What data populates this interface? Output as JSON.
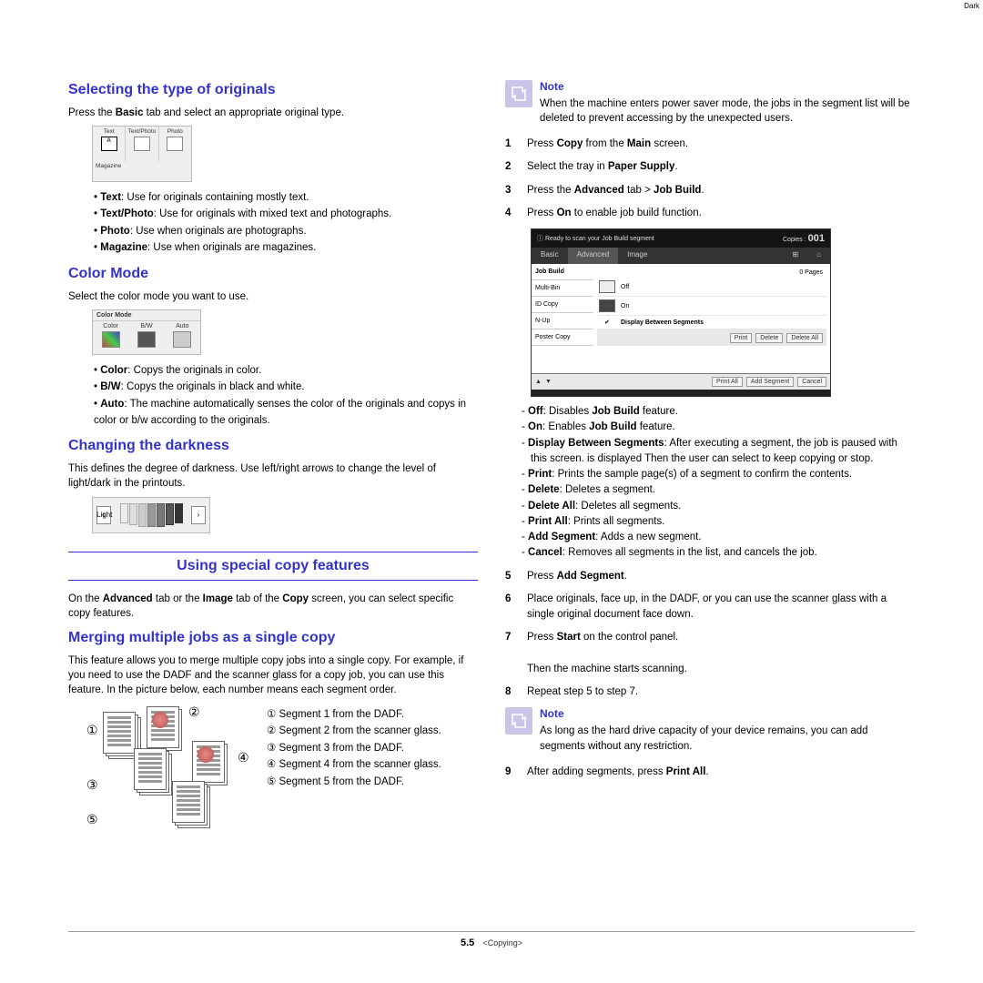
{
  "left": {
    "h_originals": "Selecting the type of originals",
    "p_originals_pre": "Press the ",
    "p_originals_b": "Basic",
    "p_originals_post": " tab and select an appropriate original type.",
    "orig_labels": {
      "text": "Text",
      "textphoto": "Text/Photo",
      "photo": "Photo",
      "magazine": "Magazine"
    },
    "originals": [
      {
        "b": "Text",
        "t": ": Use for originals containing mostly text."
      },
      {
        "b": "Text/Photo",
        "t": ": Use for originals with mixed text and photographs."
      },
      {
        "b": "Photo",
        "t": ": Use when originals are photographs."
      },
      {
        "b": "Magazine",
        "t": ": Use when originals are magazines."
      }
    ],
    "h_color": "Color Mode",
    "p_color": "Select the color mode you want to use.",
    "color_labels": {
      "title": "Color Mode",
      "color": "Color",
      "bw": "B/W",
      "auto": "Auto"
    },
    "colors": [
      {
        "b": "Color",
        "t": ": Copys the originals in color."
      },
      {
        "b": "B/W",
        "t": ": Copys the originals in black and white."
      },
      {
        "b": "Auto",
        "t": ": The machine automatically senses the color of the originals and copys in color or b/w according to the originals."
      }
    ],
    "h_dark": "Changing the darkness",
    "p_dark": "This defines the degree of darkness. Use left/right arrows to change the level of light/dark in the printouts.",
    "dark_labels": {
      "light": "Light",
      "dark": "Dark"
    },
    "h_special": "Using special copy features",
    "p_special": {
      "pre": "On the ",
      "b1": "Advanced",
      "mid": " tab or the ",
      "b2": "Image",
      "mid2": " tab of the ",
      "b3": "Copy",
      "post": " screen, you can select specific copy features."
    },
    "h_merge": "Merging multiple jobs as a single copy",
    "p_merge": "This feature allows you to merge multiple copy jobs into a single copy. For example, if you need to use the DADF and the scanner glass for a copy job, you can use this feature. In the picture below, each number means each segment order.",
    "segments": [
      "① Segment 1 from the DADF.",
      "② Segment 2 from the scanner glass.",
      "③ Segment 3 from the DADF.",
      "④ Segment 4 from the scanner glass.",
      "⑤ Segment 5 from the DADF."
    ],
    "seg_nums": {
      "n1": "①",
      "n2": "②",
      "n3": "③",
      "n4": "④",
      "n5": "⑤"
    }
  },
  "right": {
    "note1_title": "Note",
    "note1_body": "When the machine enters power saver mode, the jobs in the segment list will be deleted to prevent accessing by the unexpected users.",
    "steps14": [
      {
        "n": "1",
        "pre": "Press ",
        "b": "Copy",
        "mid": " from the ",
        "b2": "Main",
        "post": " screen."
      },
      {
        "n": "2",
        "pre": "Select the tray in ",
        "b": "Paper Supply",
        "post": "."
      },
      {
        "n": "3",
        "pre": "Press the ",
        "b": "Advanced",
        "mid": " tab > ",
        "b2": "Job Build",
        "post": "."
      },
      {
        "n": "4",
        "pre": "Press ",
        "b": "On",
        "post": " to enable job build function."
      }
    ],
    "ui": {
      "title_pre": "Ready to scan your Job Build segment",
      "copies_label": "Copies :",
      "copies": "001",
      "tabs": [
        "Basic",
        "Advanced",
        "Image"
      ],
      "side": [
        "Job Build",
        "Multi-Bin",
        "ID Copy",
        "N-Up",
        "Poster Copy"
      ],
      "pages": "0 Pages",
      "off": "Off",
      "on": "On",
      "disp": "Display Between Segments",
      "buttons": [
        "Print",
        "Delete",
        "Delete All",
        "Print All",
        "Add Segment",
        "Cancel"
      ]
    },
    "dashes": [
      {
        "b": "Off",
        "t": ": Disables ",
        "b2": "Job Build",
        "t2": " feature."
      },
      {
        "b": "On",
        "t": ": Enables ",
        "b2": "Job Build",
        "t2": " feature."
      },
      {
        "b": "Display Between Segments",
        "t": ": After executing a segment, the job is paused with this screen. is displayed Then the user can select to keep copying or stop."
      },
      {
        "b": "Print",
        "t": ": Prints the sample page(s) of a segment to confirm the contents."
      },
      {
        "b": "Delete",
        "t": ": Deletes a segment."
      },
      {
        "b": "Delete All",
        "t": ": Deletes all segments."
      },
      {
        "b": "Print All",
        "t": ": Prints all segments."
      },
      {
        "b": "Add Segment",
        "t": ": Adds a new segment."
      },
      {
        "b": "Cancel",
        "t": ": Removes all segments in the list, and cancels the job."
      }
    ],
    "steps58": [
      {
        "n": "5",
        "pre": "Press ",
        "b": "Add Segment",
        "post": "."
      },
      {
        "n": "6",
        "plain": "Place originals, face up, in the DADF, or you can use the scanner glass with a single original document face down."
      },
      {
        "n": "7",
        "pre": "Press ",
        "b": "Start",
        "post": " on the control panel.",
        "extra": "Then the machine starts scanning."
      },
      {
        "n": "8",
        "plain": "Repeat step 5 to step 7."
      }
    ],
    "note2_title": "Note",
    "note2_body": "As long as the hard drive capacity of your device remains, you can add segments without any restriction.",
    "step9": {
      "n": "9",
      "pre": "After adding segments, press ",
      "b": "Print All",
      "post": "."
    }
  },
  "footer": {
    "page": "5.5",
    "section": "<Copying>"
  }
}
